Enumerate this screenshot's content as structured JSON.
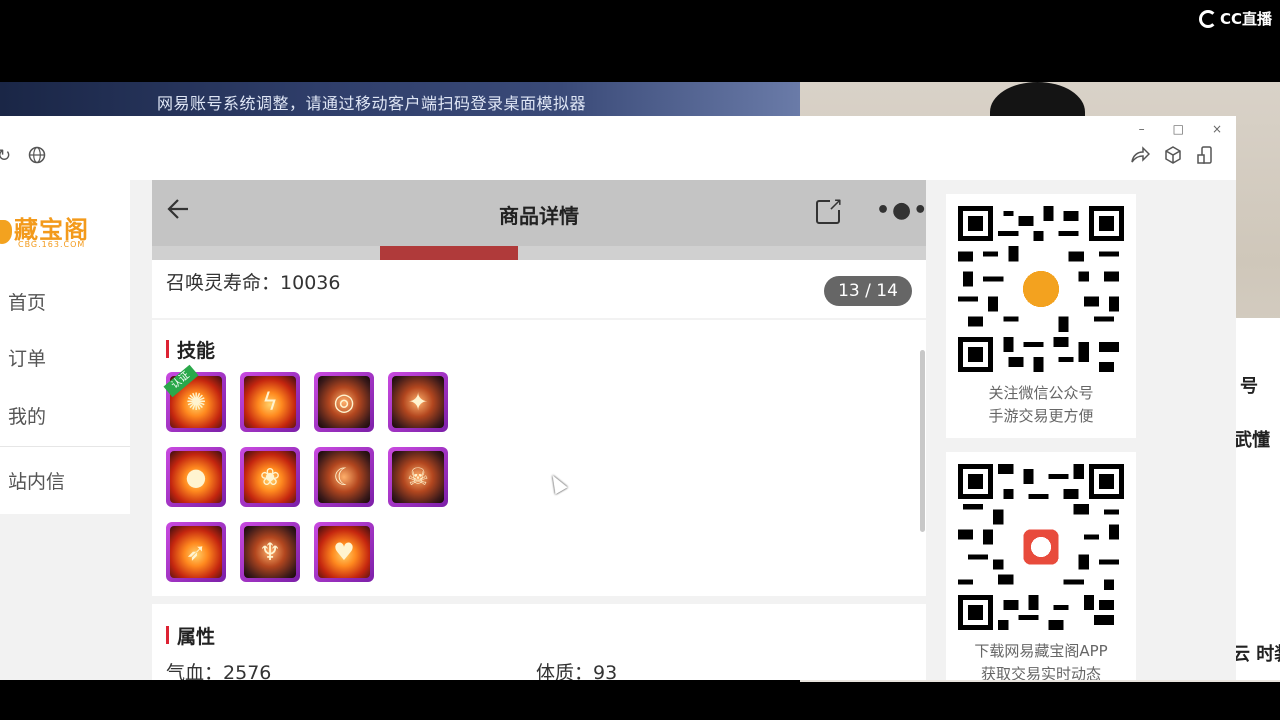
{
  "watermark": {
    "text": "CC直播"
  },
  "background": {
    "notice": "网易账号系统调整，请通过移动客户端扫码登录桌面模拟器",
    "right_labels": [
      "号",
      "武懂",
      "云 时装"
    ]
  },
  "window": {
    "controls": [
      "–",
      "□",
      "×"
    ],
    "toolbar_icons": [
      "refresh-icon",
      "globe-icon",
      "share-icon",
      "cube-icon",
      "phone-icon"
    ]
  },
  "nav": {
    "logo_text": "藏宝阁",
    "logo_sub": "CBG.163.COM",
    "items": [
      {
        "label": "首页"
      },
      {
        "label": "订单"
      },
      {
        "label": "我的"
      },
      {
        "label": "站内信"
      }
    ]
  },
  "phone": {
    "header_title": "商品详情",
    "summon_life_label": "召唤灵寿命：",
    "summon_life_value": "10036",
    "pager": "13 / 14",
    "skills_title": "技能",
    "skills_badge": "认证",
    "skills": [
      {
        "icon": "flame-swirl-icon"
      },
      {
        "icon": "lightning-icon"
      },
      {
        "icon": "storm-icon"
      },
      {
        "icon": "axe-icon"
      },
      {
        "icon": "fire-orb-icon"
      },
      {
        "icon": "rabbit-icon"
      },
      {
        "icon": "moon-flame-icon"
      },
      {
        "icon": "demon-face-icon"
      },
      {
        "icon": "fire-arrow-icon"
      },
      {
        "icon": "demon-mask-icon"
      },
      {
        "icon": "heart-flame-icon"
      }
    ],
    "attrs_title": "属性",
    "attrs": [
      {
        "label": "气血：",
        "value": "2576"
      },
      {
        "label": "体质：",
        "value": "93"
      }
    ]
  },
  "qr_panels": [
    {
      "line1": "关注微信公众号",
      "line2": "手游交易更方便"
    },
    {
      "line1": "下载网易藏宝阁APP",
      "line2": "获取交易实时动态"
    }
  ]
}
